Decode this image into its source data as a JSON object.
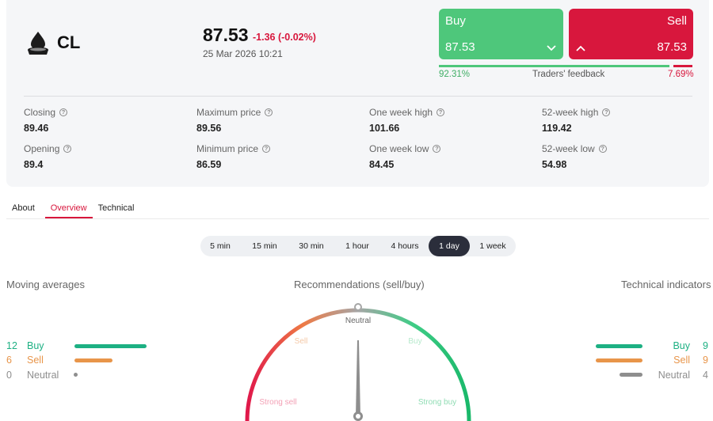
{
  "instrument": {
    "icon": "oil-drop-icon",
    "ticker": "CL",
    "price": "87.53",
    "change": "-1.36 (-0.02%)",
    "datetime": "25 Mar 2026 10:21"
  },
  "trade": {
    "buy_label": "Buy",
    "buy_price": "87.53",
    "sell_label": "Sell",
    "sell_price": "87.53",
    "feedback_buy": "92.31%",
    "feedback_label": "Traders' feedback",
    "feedback_sell": "7.69%",
    "feedback_buy_fraction": 0.9231
  },
  "stats": {
    "closing": {
      "label": "Closing",
      "value": "89.46"
    },
    "opening": {
      "label": "Opening",
      "value": "89.4"
    },
    "max_price": {
      "label": "Maximum price",
      "value": "89.56"
    },
    "min_price": {
      "label": "Minimum price",
      "value": "86.59"
    },
    "week_high": {
      "label": "One week high",
      "value": "101.66"
    },
    "week_low": {
      "label": "One week low",
      "value": "84.45"
    },
    "year_high": {
      "label": "52-week high",
      "value": "119.42"
    },
    "year_low": {
      "label": "52-week low",
      "value": "54.98"
    }
  },
  "tabs": [
    {
      "label": "About"
    },
    {
      "label": "Overview",
      "active": true
    },
    {
      "label": "Technical"
    }
  ],
  "timeframes": [
    {
      "label": "5 min"
    },
    {
      "label": "15 min"
    },
    {
      "label": "30 min"
    },
    {
      "label": "1 hour"
    },
    {
      "label": "4 hours"
    },
    {
      "label": "1 day",
      "active": true
    },
    {
      "label": "1 week"
    }
  ],
  "moving_averages": {
    "title": "Moving averages",
    "buy": {
      "count": "12",
      "label": "Buy"
    },
    "sell": {
      "count": "6",
      "label": "Sell"
    },
    "neutral": {
      "count": "0",
      "label": "Neutral"
    }
  },
  "recommendations": {
    "title": "Recommendations (sell/buy)",
    "neutral": "Neutral",
    "sell": "Sell",
    "buy": "Buy",
    "strong_sell": "Strong sell",
    "strong_buy": "Strong buy"
  },
  "technical_indicators": {
    "title": "Technical indicators",
    "buy": {
      "count": "9",
      "label": "Buy"
    },
    "sell": {
      "count": "9",
      "label": "Sell"
    },
    "neutral": {
      "count": "4",
      "label": "Neutral"
    }
  },
  "colors": {
    "buy": "#4ec77b",
    "sell": "#d8173d",
    "ind_buy": "#1db083",
    "ind_sell": "#e8954a",
    "neutral": "#8e8e8e"
  }
}
